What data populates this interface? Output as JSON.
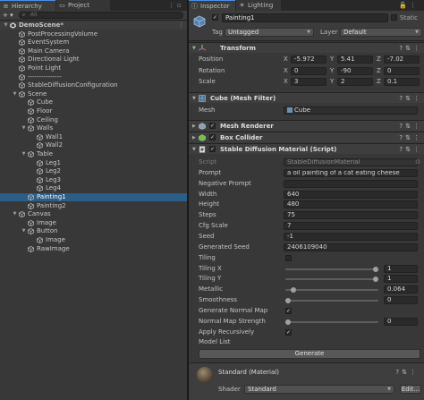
{
  "hierarchy": {
    "tab_label": "Hierarchy",
    "project_tab_label": "Project",
    "add_label": "+ ▾",
    "search_placeholder": "All",
    "items": [
      {
        "label": "DemoScene*",
        "depth": 0,
        "arrow": "▼",
        "icon": "unity-scene-icon",
        "scene": true
      },
      {
        "label": "PostProcessingVolume",
        "depth": 1,
        "arrow": "",
        "icon": "gameobject-icon"
      },
      {
        "label": "EventSystem",
        "depth": 1,
        "arrow": "",
        "icon": "gameobject-icon"
      },
      {
        "label": "Main Camera",
        "depth": 1,
        "arrow": "",
        "icon": "gameobject-icon"
      },
      {
        "label": "Directional Light",
        "depth": 1,
        "arrow": "",
        "icon": "gameobject-icon"
      },
      {
        "label": "Point Light",
        "depth": 1,
        "arrow": "",
        "icon": "gameobject-icon"
      },
      {
        "label": "---------------",
        "depth": 1,
        "arrow": "",
        "icon": "gameobject-icon"
      },
      {
        "label": "StableDiffusionConfiguration",
        "depth": 1,
        "arrow": "",
        "icon": "gameobject-icon"
      },
      {
        "label": "Scene",
        "depth": 1,
        "arrow": "▼",
        "icon": "gameobject-icon"
      },
      {
        "label": "Cube",
        "depth": 2,
        "arrow": "",
        "icon": "gameobject-icon"
      },
      {
        "label": "Floor",
        "depth": 2,
        "arrow": "",
        "icon": "gameobject-icon"
      },
      {
        "label": "Ceiling",
        "depth": 2,
        "arrow": "",
        "icon": "gameobject-icon"
      },
      {
        "label": "Walls",
        "depth": 2,
        "arrow": "▼",
        "icon": "gameobject-icon"
      },
      {
        "label": "Wall1",
        "depth": 3,
        "arrow": "",
        "icon": "gameobject-icon"
      },
      {
        "label": "Wall2",
        "depth": 3,
        "arrow": "",
        "icon": "gameobject-icon"
      },
      {
        "label": "Table",
        "depth": 2,
        "arrow": "▼",
        "icon": "gameobject-icon"
      },
      {
        "label": "Leg1",
        "depth": 3,
        "arrow": "",
        "icon": "gameobject-icon"
      },
      {
        "label": "Leg2",
        "depth": 3,
        "arrow": "",
        "icon": "gameobject-icon"
      },
      {
        "label": "Leg3",
        "depth": 3,
        "arrow": "",
        "icon": "gameobject-icon"
      },
      {
        "label": "Leg4",
        "depth": 3,
        "arrow": "",
        "icon": "gameobject-icon"
      },
      {
        "label": "Painting1",
        "depth": 2,
        "arrow": "",
        "icon": "gameobject-icon",
        "selected": true
      },
      {
        "label": "Painting2",
        "depth": 2,
        "arrow": "",
        "icon": "gameobject-icon"
      },
      {
        "label": "Canvas",
        "depth": 1,
        "arrow": "▼",
        "icon": "gameobject-icon"
      },
      {
        "label": "Image",
        "depth": 2,
        "arrow": "",
        "icon": "gameobject-icon"
      },
      {
        "label": "Button",
        "depth": 2,
        "arrow": "▼",
        "icon": "gameobject-icon"
      },
      {
        "label": "Image",
        "depth": 3,
        "arrow": "",
        "icon": "gameobject-icon"
      },
      {
        "label": "RawImage",
        "depth": 2,
        "arrow": "",
        "icon": "gameobject-icon"
      }
    ]
  },
  "inspector": {
    "tab_label": "Inspector",
    "lighting_tab_label": "Lighting",
    "object_name": "Painting1",
    "static_label": "Static",
    "tag_label": "Tag",
    "tag_value": "Untagged",
    "layer_label": "Layer",
    "layer_value": "Default",
    "transform": {
      "title": "Transform",
      "position_label": "Position",
      "rotation_label": "Rotation",
      "scale_label": "Scale",
      "axis_x": "X",
      "axis_y": "Y",
      "axis_z": "Z",
      "position": {
        "x": "-5.972",
        "y": "5.41",
        "z": "-7.02"
      },
      "rotation": {
        "x": "0",
        "y": "-90",
        "z": "0"
      },
      "scale": {
        "x": "3",
        "y": "2",
        "z": "0.1"
      }
    },
    "mesh_filter": {
      "title": "Cube (Mesh Filter)",
      "mesh_label": "Mesh",
      "mesh_value": "Cube"
    },
    "mesh_renderer_title": "Mesh Renderer",
    "box_collider_title": "Box Collider",
    "sd_material": {
      "title": "Stable Diffusion Material (Script)",
      "script_label": "Script",
      "script_value": "StableDiffusionMaterial",
      "prompt_label": "Prompt",
      "prompt_value": "a oil painting of a cat eating cheese",
      "negative_prompt_label": "Negative Prompt",
      "negative_prompt_value": "",
      "width_label": "Width",
      "width_value": "640",
      "height_label": "Height",
      "height_value": "480",
      "steps_label": "Steps",
      "steps_value": "75",
      "cfg_label": "Cfg Scale",
      "cfg_value": "7",
      "seed_label": "Seed",
      "seed_value": "-1",
      "gen_seed_label": "Generated Seed",
      "gen_seed_value": "2406109040",
      "tiling_label": "Tiling",
      "tiling_x_label": "Tiling X",
      "tiling_x_value": "1",
      "tiling_x_fill": 1.0,
      "tiling_y_label": "Tiling Y",
      "tiling_y_value": "1",
      "tiling_y_fill": 1.0,
      "metallic_label": "Metallic",
      "metallic_value": "0.064",
      "metallic_fill": 0.064,
      "smoothness_label": "Smoothness",
      "smoothness_value": "0",
      "smoothness_fill": 0.0,
      "normal_map_label": "Generate Normal Map",
      "normal_strength_label": "Normal Map Strength",
      "normal_strength_value": "0",
      "normal_strength_fill": 0.0,
      "apply_recursive_label": "Apply Recursively",
      "model_list_label": "Model List",
      "generate_button": "Generate"
    },
    "material": {
      "title": "Standard (Material)",
      "shader_label": "Shader",
      "shader_value": "Standard",
      "edit_label": "Edit..."
    }
  }
}
